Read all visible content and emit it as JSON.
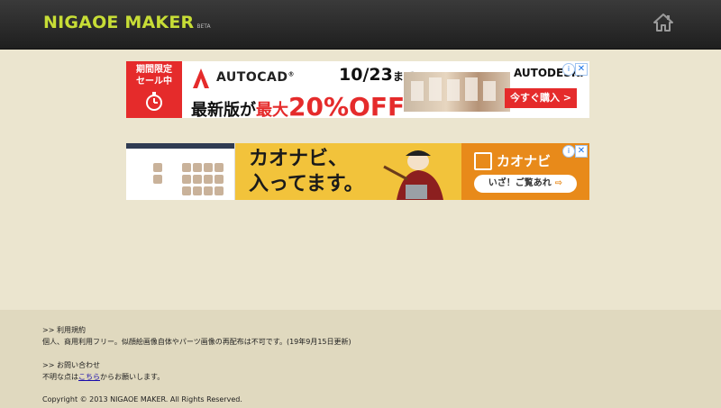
{
  "header": {
    "logo_text": "NIGAOE MAKER",
    "logo_badge": "BETA",
    "home_icon": "home-icon"
  },
  "ads": {
    "autocad": {
      "badge_line1": "期間限定",
      "badge_line2": "セール中",
      "timer_icon": "stopwatch-icon",
      "product": "AUTOCAD",
      "product_mark": "®",
      "date": "10/23",
      "date_suffix": "まで",
      "headline_a": "最新版が",
      "headline_b": "最大",
      "headline_c": "20%OFF",
      "brand": "AUTODESK.",
      "cta": "今すぐ購入 >"
    },
    "kaonavi": {
      "copy_line1": "カオナビ、",
      "copy_line2": "入ってます。",
      "brand": "カオナビ",
      "cta": "いざ！ご覧あれ",
      "cta_icon": "arrow-circle-icon"
    },
    "close_icon": "close-icon",
    "info_icon": "adchoices-icon"
  },
  "footer": {
    "terms_heading": ">> 利用規約",
    "terms_text": "個人、商用利用フリー。似顔絵画像自体やパーツ画像の再配布は不可です。(19年9月15日更新)",
    "contact_heading": ">> お問い合わせ",
    "contact_prefix": "不明な点は",
    "contact_link": "こちら",
    "contact_suffix": "からお願いします。",
    "copyright": "Copyright © 2013 NIGAOE MAKER. All Rights Reserved."
  }
}
